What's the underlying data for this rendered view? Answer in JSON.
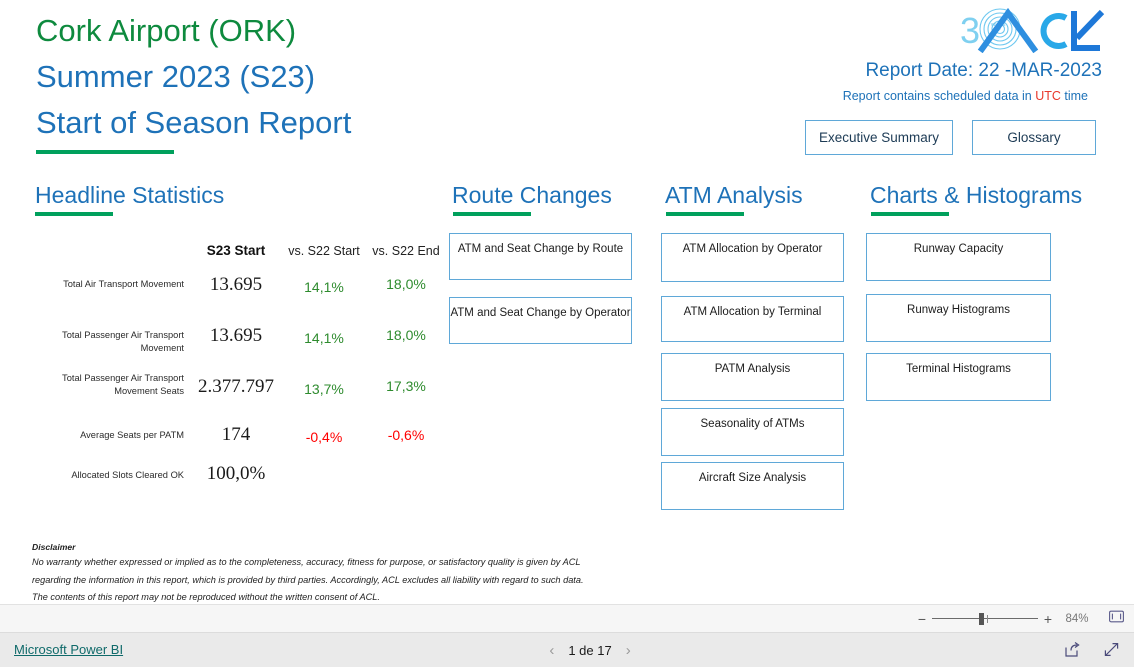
{
  "report": {
    "title_line1": "Cork Airport (ORK)",
    "title_line2": "Summer 2023 (S23)",
    "title_line3": "Start of Season Report",
    "report_date": "Report Date: 22 -MAR-2023",
    "report_sub_prefix": "Report contains scheduled data in ",
    "report_sub_utc": "UTC",
    "report_sub_suffix": " time",
    "logo_text": "ACL",
    "logo_badge": "30"
  },
  "header_buttons": {
    "executive_summary": "Executive Summary",
    "glossary": "Glossary"
  },
  "sections": {
    "headline": "Headline Statistics",
    "route_changes": "Route Changes",
    "atm_analysis": "ATM Analysis",
    "charts_histograms": "Charts & Histograms"
  },
  "stats_table": {
    "columns": [
      "",
      "S23 Start",
      "vs. S22 Start",
      "vs. S22 End"
    ],
    "rows": [
      {
        "label": "Total Air Transport Movement",
        "value": "13.695",
        "vs_start": "14,1%",
        "vs_end": "18,0%",
        "vs_start_sign": "pos",
        "vs_end_sign": "pos"
      },
      {
        "label": "Total Passenger Air Transport Movement",
        "value": "13.695",
        "vs_start": "14,1%",
        "vs_end": "18,0%",
        "vs_start_sign": "pos",
        "vs_end_sign": "pos"
      },
      {
        "label": "Total Passenger Air Transport Movement Seats",
        "value": "2.377.797",
        "vs_start": "13,7%",
        "vs_end": "17,3%",
        "vs_start_sign": "pos",
        "vs_end_sign": "pos"
      },
      {
        "label": "Average Seats per PATM",
        "value": "174",
        "vs_start": "-0,4%",
        "vs_end": "-0,6%",
        "vs_start_sign": "neg",
        "vs_end_sign": "neg"
      },
      {
        "label": "Allocated Slots Cleared OK",
        "value": "100,0%",
        "vs_start": "",
        "vs_end": "",
        "vs_start_sign": "pos",
        "vs_end_sign": "pos"
      }
    ]
  },
  "route_changes_items": [
    "ATM and Seat Change by Route",
    "ATM and Seat Change by Operator"
  ],
  "atm_analysis_items": [
    "ATM Allocation by Operator",
    "ATM Allocation by Terminal",
    "PATM Analysis",
    "Seasonality of ATMs",
    "Aircraft Size Analysis"
  ],
  "charts_items": [
    "Runway Capacity",
    "Runway Histograms",
    "Terminal Histograms"
  ],
  "disclaimer": {
    "heading": "Disclaimer",
    "line1": "No warranty whether expressed or implied as to the completeness, accuracy, fitness for purpose, or satisfactory quality is given by ACL",
    "line2": "regarding the information in this report, which is provided by third parties. Accordingly, ACL excludes all liability with regard to such data.",
    "line3": "The contents of this report may not be reproduced without the written consent of ACL."
  },
  "zoombar": {
    "minus": "−",
    "plus": "+",
    "percent": "84%"
  },
  "footer": {
    "brand_link": "Microsoft Power BI",
    "page_label": "1 de 17",
    "prev": "‹",
    "next": "›"
  },
  "colors": {
    "green_accent": "#00A05C",
    "blue_heading": "#1E72B8",
    "title_green": "#0E8A3E",
    "positive": "#2E8B2E",
    "negative": "#FF0000",
    "box_border": "#5FA8D8",
    "utc_red": "#E8382B",
    "link_teal": "#0F6A6A"
  }
}
